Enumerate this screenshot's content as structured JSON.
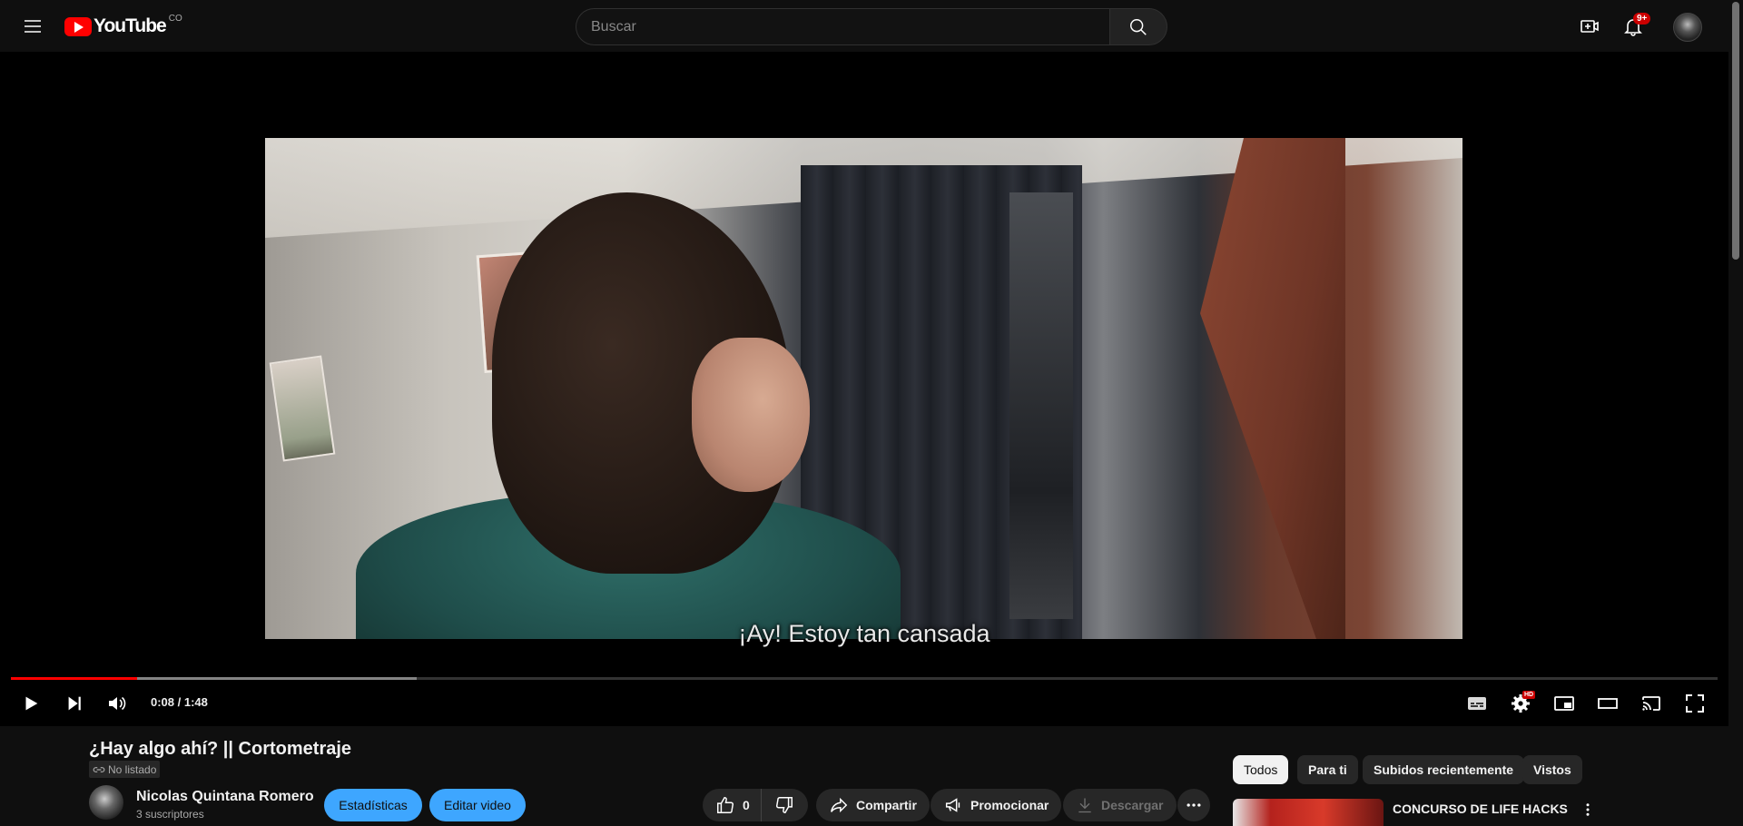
{
  "header": {
    "logo_text": "YouTube",
    "country_code": "CO",
    "search_placeholder": "Buscar",
    "notification_count": "9+"
  },
  "player": {
    "subtitle": "¡Ay! Estoy tan cansada",
    "current_time": "0:08",
    "duration": "1:48",
    "time_display": "0:08 / 1:48",
    "progress_played_fraction": 0.074,
    "progress_buffered_fraction": 0.238,
    "hd_badge": "HD"
  },
  "video": {
    "title": "¿Hay algo ahí? || Cortometraje",
    "visibility": "No listado",
    "channel_name": "Nicolas Quintana Romero",
    "subscribers": "3 suscriptores",
    "stats_button": "Estadísticas",
    "edit_button": "Editar video",
    "like_count": "0",
    "share_label": "Compartir",
    "promote_label": "Promocionar",
    "download_label": "Descargar"
  },
  "sidebar": {
    "chips": [
      {
        "label": "Todos",
        "active": true
      },
      {
        "label": "Para ti",
        "active": false
      },
      {
        "label": "Subidos recientemente",
        "active": false
      },
      {
        "label": "Vistos",
        "active": false
      }
    ],
    "recommendation_title": "CONCURSO DE LIFE HACKS"
  },
  "colors": {
    "brand_red": "#ff0000",
    "accent_blue": "#3ea6ff",
    "background": "#0f0f0f",
    "chip_bg": "#272727"
  }
}
